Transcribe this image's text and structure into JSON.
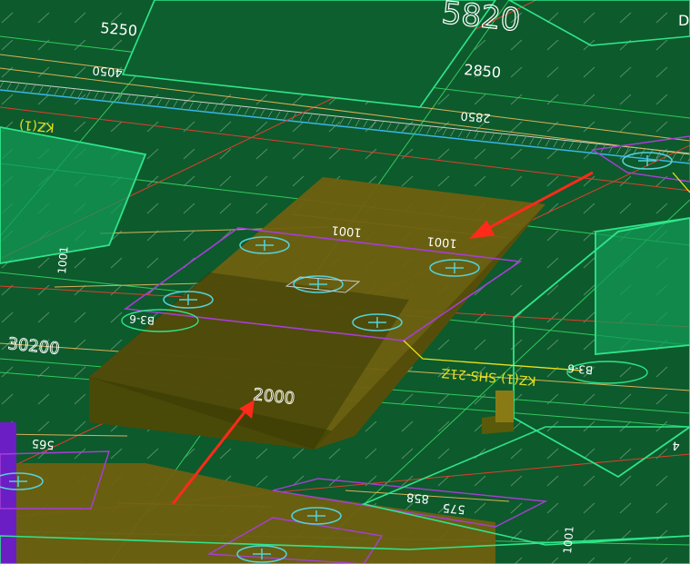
{
  "viewport": {
    "background": "#0d5a2c"
  },
  "dimensions": {
    "d_5250": "5250",
    "d_5820": "5820",
    "d_D": "D",
    "d_4050": "4050",
    "d_2850": "2850",
    "d_2850b": "2850",
    "d_30200": "30200",
    "d_2000": "2000",
    "d_1001a": "1001",
    "d_1001b": "1001",
    "d_1001c": "1001",
    "d_565": "565",
    "d_858": "858",
    "d_575": "575",
    "d_4": "4",
    "d_1001d": "1001"
  },
  "labels": {
    "tag_left": "KZ(1)",
    "tag_center": "KZ(1)-SHS-21Z",
    "tag_ref_left": "B3-6",
    "tag_ref_right": "B3-6"
  },
  "colors": {
    "accent_green": "#35e08a",
    "gold": "#d9b15a",
    "purple": "#a63fd6",
    "cyan": "#54d2d8",
    "red_arrow": "#ff2a1a",
    "yellow_text": "#e8e21c"
  },
  "icons": [
    "pile-marker-icon",
    "arrow-icon"
  ]
}
